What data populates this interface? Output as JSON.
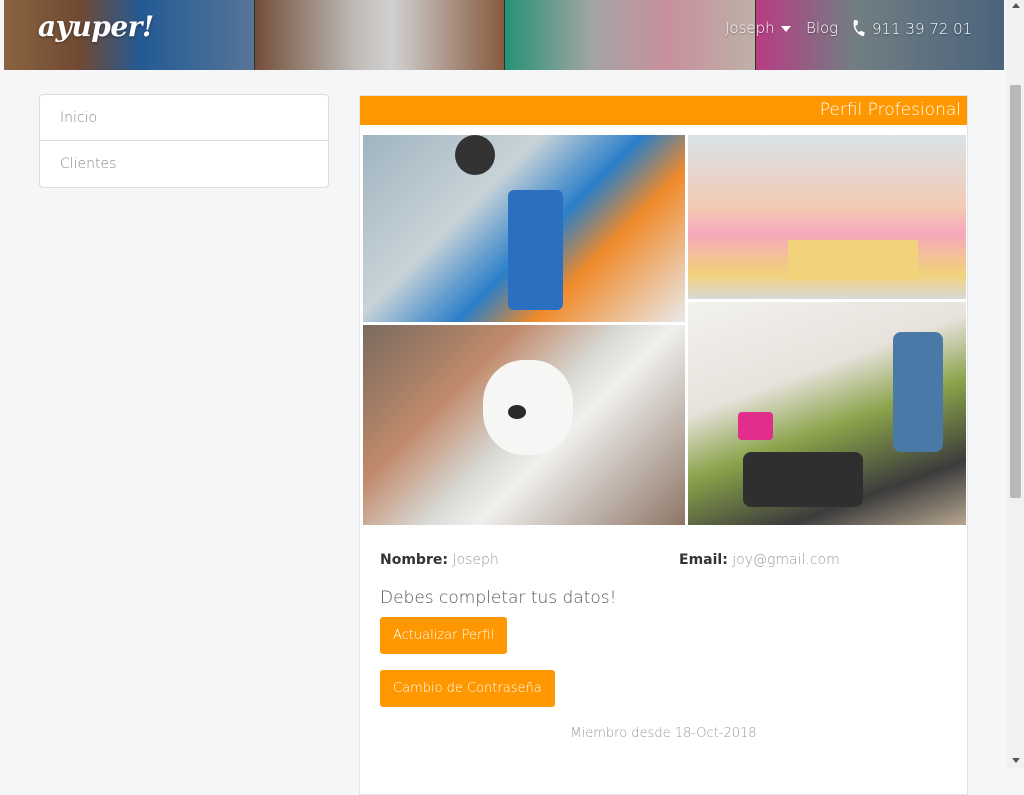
{
  "header": {
    "logo": "ayuper!",
    "user_menu": "Joseph",
    "blog_link": "Blog",
    "phone": "911 39 72 01"
  },
  "sidebar": {
    "items": [
      {
        "label": "Inicio"
      },
      {
        "label": "Clientes"
      }
    ]
  },
  "profile": {
    "panel_title": "Perfil Profesional",
    "name_label": "Nombre:",
    "name_value": "Joseph",
    "email_label": "Email:",
    "email_value": "joy@gmail.com",
    "notice": "Debes completar tus datos!",
    "update_button": "Actualizar Perfil",
    "password_button": "Cambio de Contraseña",
    "member_since": "Miembro desde 18-Oct-2018"
  },
  "colors": {
    "accent": "#ff9800",
    "page_bg": "#f5f6f8"
  }
}
